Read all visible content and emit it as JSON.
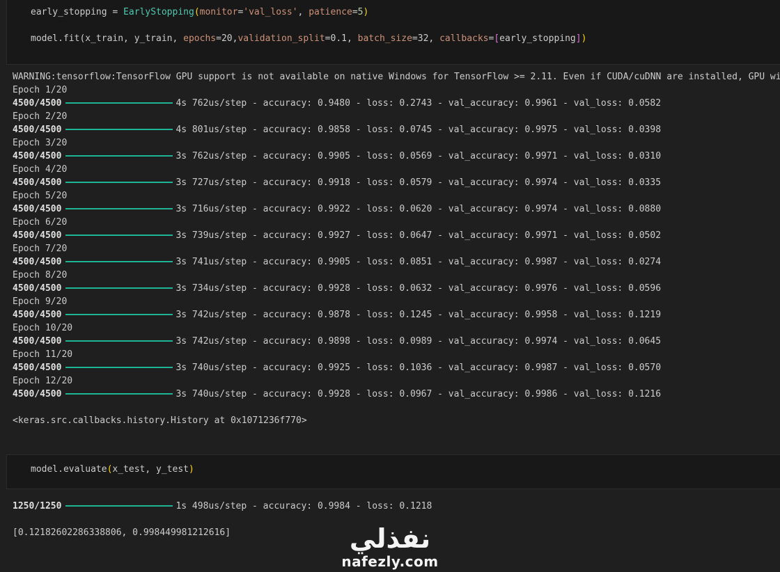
{
  "cell1": {
    "line1": {
      "var": "early_stopping = ",
      "cls": "EarlyStopping",
      "open": "(",
      "p1": "monitor",
      "eq1": "=",
      "s1": "'val_loss'",
      "sep": ", ",
      "p2": "patience",
      "eq2": "=",
      "n2": "5",
      "close": ")"
    },
    "line2": {
      "fn": "model.fit(x_train, y_train, ",
      "p1": "epochs",
      "v1": "=20,",
      "p2": "validation_split",
      "v2": "=0.1, ",
      "p3": "batch_size",
      "v3": "=32, ",
      "p4": "callbacks",
      "v4": "=",
      "lb": "[",
      "v5": "early_stopping",
      "rb": "]",
      "close": ")"
    }
  },
  "output1": {
    "warning": "WARNING:tensorflow:TensorFlow GPU support is not available on native Windows for TensorFlow >= 2.11. Even if CUDA/cuDNN are installed, GPU will",
    "epochs": [
      {
        "epoch": "Epoch 1/20",
        "steps": "4500/4500",
        "time": "4s 762us/step - accuracy: 0.9480 - loss: 0.2743 - val_accuracy: 0.9961 - val_loss: 0.0582"
      },
      {
        "epoch": "Epoch 2/20",
        "steps": "4500/4500",
        "time": "4s 801us/step - accuracy: 0.9858 - loss: 0.0745 - val_accuracy: 0.9975 - val_loss: 0.0398"
      },
      {
        "epoch": "Epoch 3/20",
        "steps": "4500/4500",
        "time": "3s 762us/step - accuracy: 0.9905 - loss: 0.0569 - val_accuracy: 0.9971 - val_loss: 0.0310"
      },
      {
        "epoch": "Epoch 4/20",
        "steps": "4500/4500",
        "time": "3s 727us/step - accuracy: 0.9918 - loss: 0.0579 - val_accuracy: 0.9974 - val_loss: 0.0335"
      },
      {
        "epoch": "Epoch 5/20",
        "steps": "4500/4500",
        "time": "3s 716us/step - accuracy: 0.9922 - loss: 0.0620 - val_accuracy: 0.9974 - val_loss: 0.0880"
      },
      {
        "epoch": "Epoch 6/20",
        "steps": "4500/4500",
        "time": "3s 739us/step - accuracy: 0.9927 - loss: 0.0647 - val_accuracy: 0.9971 - val_loss: 0.0502"
      },
      {
        "epoch": "Epoch 7/20",
        "steps": "4500/4500",
        "time": "3s 741us/step - accuracy: 0.9905 - loss: 0.0851 - val_accuracy: 0.9987 - val_loss: 0.0274"
      },
      {
        "epoch": "Epoch 8/20",
        "steps": "4500/4500",
        "time": "3s 734us/step - accuracy: 0.9928 - loss: 0.0632 - val_accuracy: 0.9976 - val_loss: 0.0596"
      },
      {
        "epoch": "Epoch 9/20",
        "steps": "4500/4500",
        "time": "3s 742us/step - accuracy: 0.9878 - loss: 0.1245 - val_accuracy: 0.9958 - val_loss: 0.1219"
      },
      {
        "epoch": "Epoch 10/20",
        "steps": "4500/4500",
        "time": "3s 742us/step - accuracy: 0.9898 - loss: 0.0989 - val_accuracy: 0.9974 - val_loss: 0.0645"
      },
      {
        "epoch": "Epoch 11/20",
        "steps": "4500/4500",
        "time": "3s 740us/step - accuracy: 0.9925 - loss: 0.1036 - val_accuracy: 0.9987 - val_loss: 0.0570"
      },
      {
        "epoch": "Epoch 12/20",
        "steps": "4500/4500",
        "time": "3s 740us/step - accuracy: 0.9928 - loss: 0.0967 - val_accuracy: 0.9986 - val_loss: 0.1216"
      }
    ],
    "result": "<keras.src.callbacks.history.History at 0x1071236f770>"
  },
  "cell2": {
    "fn": "model.evaluate",
    "open": "(",
    "args": "x_test, y_test",
    "close": ")"
  },
  "output2": {
    "steps": "1250/1250",
    "time": "1s 498us/step - accuracy: 0.9984 - loss: 0.1218",
    "result": "[0.12182602286338806, 0.998449981212616]"
  },
  "watermark": {
    "arabic": "نفذلي",
    "latin": "nafezly.com"
  },
  "colors": {
    "progress_bar": "#1fb495",
    "background": "#1f1f1f",
    "cell_background": "#181818"
  }
}
